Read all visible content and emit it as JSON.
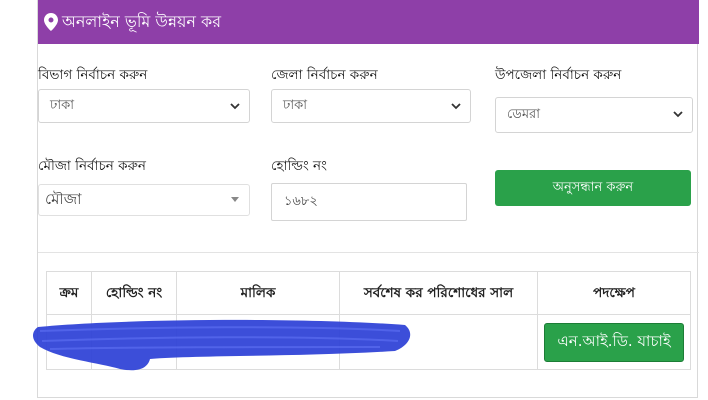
{
  "header": {
    "title": "অনলাইন ভূমি উন্নয়ন কর",
    "icon": "location-pin-icon"
  },
  "form": {
    "division": {
      "label": "বিভাগ নির্বাচন করুন",
      "value": "ঢাকা"
    },
    "district": {
      "label": "জেলা নির্বাচন করুন",
      "value": "ঢাকা"
    },
    "upazila": {
      "label": "উপজেলা নির্বাচন করুন",
      "value": "ডেমরা"
    },
    "mouza": {
      "label": "মৌজা নির্বাচন করুন",
      "value": "মৌজা"
    },
    "holding": {
      "label": "হোল্ডিং নং",
      "value": "১৬৮২"
    },
    "search_button": "অনুসন্ধান করুন"
  },
  "table": {
    "headers": [
      "ক্রম",
      "হোল্ডিং নং",
      "মালিক",
      "সর্বশেষ কর পরিশোধের সাল",
      "পদক্ষেপ"
    ],
    "row_action": "এন.আই.ডি. যাচাই"
  },
  "colors": {
    "header": "#8e3fa8",
    "button": "#2aa14a",
    "scribble": "#2b3fd6"
  }
}
